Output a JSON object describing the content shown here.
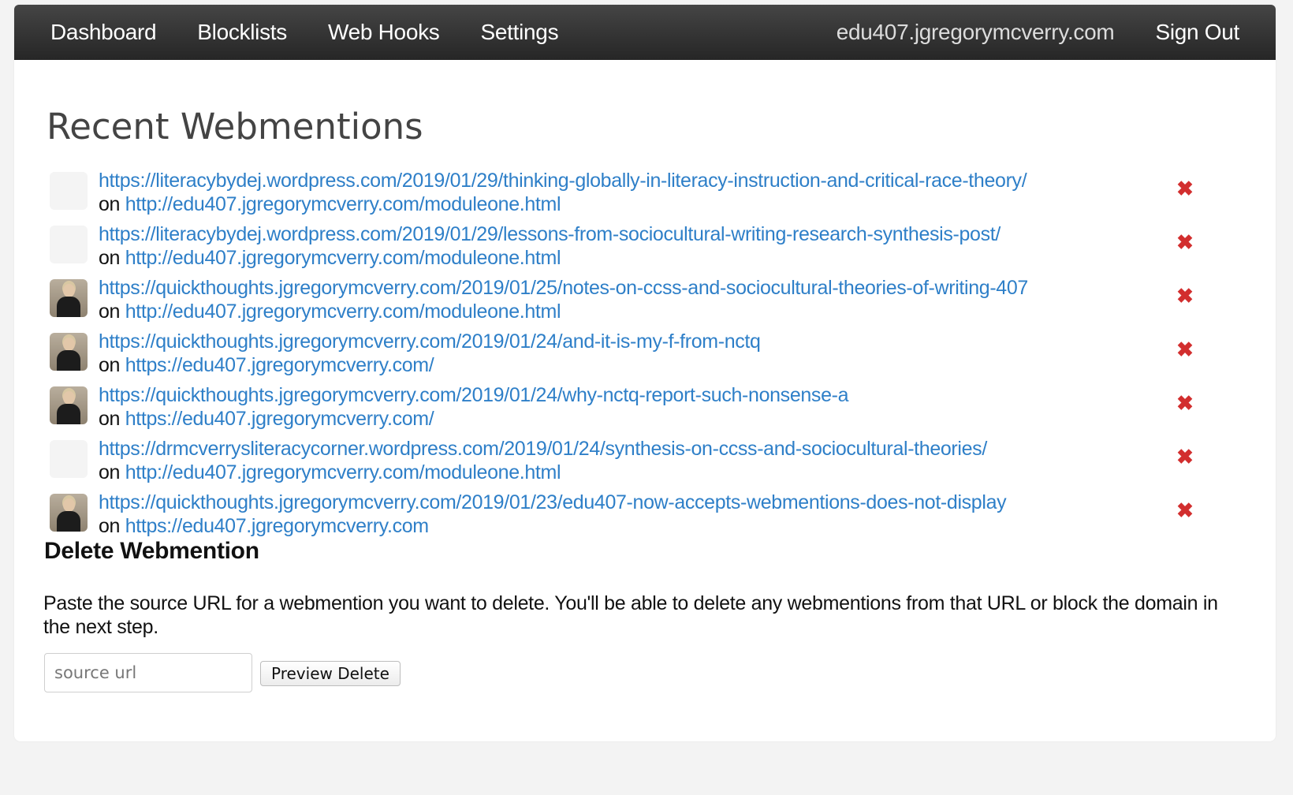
{
  "nav": {
    "links": [
      "Dashboard",
      "Blocklists",
      "Web Hooks",
      "Settings"
    ],
    "domain": "edu407.jgregorymcverry.com",
    "signout": "Sign Out"
  },
  "page_title": "Recent Webmentions",
  "mentions": [
    {
      "avatar": "blank",
      "source": "https://literacybydej.wordpress.com/2019/01/29/thinking-globally-in-literacy-instruction-and-critical-race-theory/",
      "on": "on",
      "target": "http://edu407.jgregorymcverry.com/moduleone.html"
    },
    {
      "avatar": "blank",
      "source": "https://literacybydej.wordpress.com/2019/01/29/lessons-from-sociocultural-writing-research-synthesis-post/",
      "on": "on",
      "target": "http://edu407.jgregorymcverry.com/moduleone.html"
    },
    {
      "avatar": "photo",
      "source": "https://quickthoughts.jgregorymcverry.com/2019/01/25/notes-on-ccss-and-sociocultural-theories-of-writing-407",
      "on": "on",
      "target": "http://edu407.jgregorymcverry.com/moduleone.html"
    },
    {
      "avatar": "photo",
      "source": "https://quickthoughts.jgregorymcverry.com/2019/01/24/and-it-is-my-f-from-nctq",
      "on": "on",
      "target": "https://edu407.jgregorymcverry.com/"
    },
    {
      "avatar": "photo",
      "source": "https://quickthoughts.jgregorymcverry.com/2019/01/24/why-nctq-report-such-nonsense-a",
      "on": "on",
      "target": "https://edu407.jgregorymcverry.com/"
    },
    {
      "avatar": "blank",
      "source": "https://drmcverrysliteracycorner.wordpress.com/2019/01/24/synthesis-on-ccss-and-sociocultural-theories/",
      "on": "on",
      "target": "http://edu407.jgregorymcverry.com/moduleone.html"
    },
    {
      "avatar": "photo",
      "source": "https://quickthoughts.jgregorymcverry.com/2019/01/23/edu407-now-accepts-webmentions-does-not-display",
      "on": "on",
      "target": "https://edu407.jgregorymcverry.com"
    }
  ],
  "delete_icon": "✖",
  "delete_section": {
    "title": "Delete Webmention",
    "help": "Paste the source URL for a webmention you want to delete. You'll be able to delete any webmentions from that URL or block the domain in the next step.",
    "input_placeholder": "source url",
    "input_value": "",
    "button_label": "Preview Delete"
  },
  "colors": {
    "link": "#2e7fc8",
    "delete": "#d22e2e",
    "navbar": "#2f2f2f"
  }
}
